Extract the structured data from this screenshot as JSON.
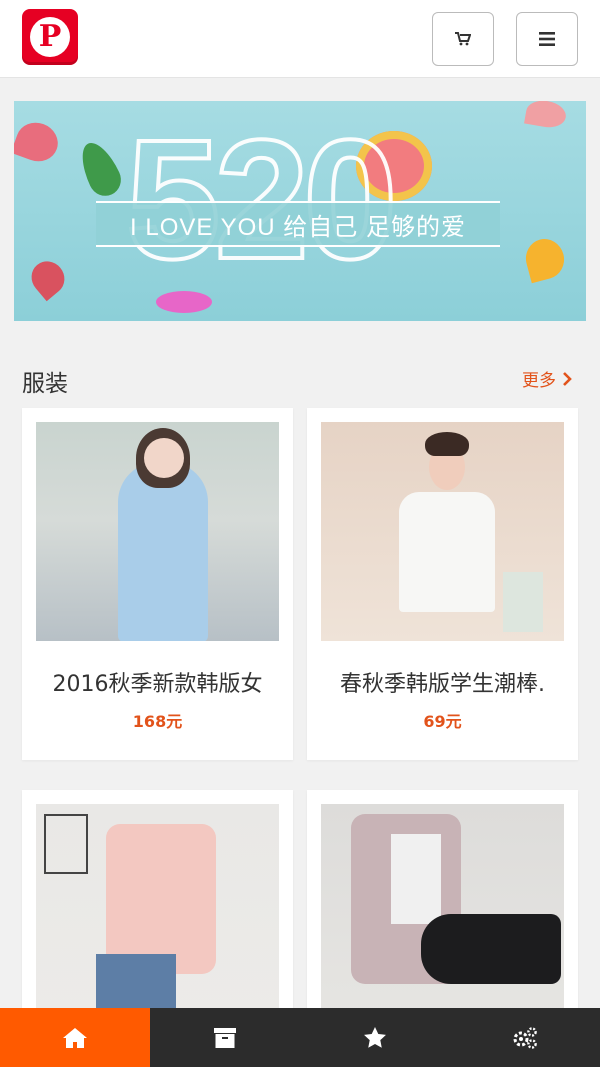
{
  "header": {
    "logo_letter": "P",
    "cart_icon": "cart-icon",
    "menu_icon": "hamburger-menu-icon"
  },
  "banner": {
    "big_number": "520",
    "tagline": "I LOVE YOU 给自己 足够的爱"
  },
  "section": {
    "title": "服装",
    "more": "更多",
    "more_icon": "chevron-right-icon"
  },
  "products": [
    {
      "name": "2016秋季新款韩版女",
      "price": "168元"
    },
    {
      "name": "春秋季韩版学生潮棒.",
      "price": "69元"
    },
    {
      "name": "",
      "price": ""
    },
    {
      "name": "",
      "price": ""
    }
  ],
  "tabbar": {
    "items": [
      {
        "icon": "home-icon",
        "active": true
      },
      {
        "icon": "archive-box-icon",
        "active": false
      },
      {
        "icon": "star-icon",
        "active": false
      },
      {
        "icon": "gears-icon",
        "active": false
      }
    ]
  },
  "colors": {
    "accent": "#e2531b",
    "tab_active": "#ff5a00",
    "tabbar_bg": "#2c2c2c",
    "logo_red": "#e60023"
  }
}
